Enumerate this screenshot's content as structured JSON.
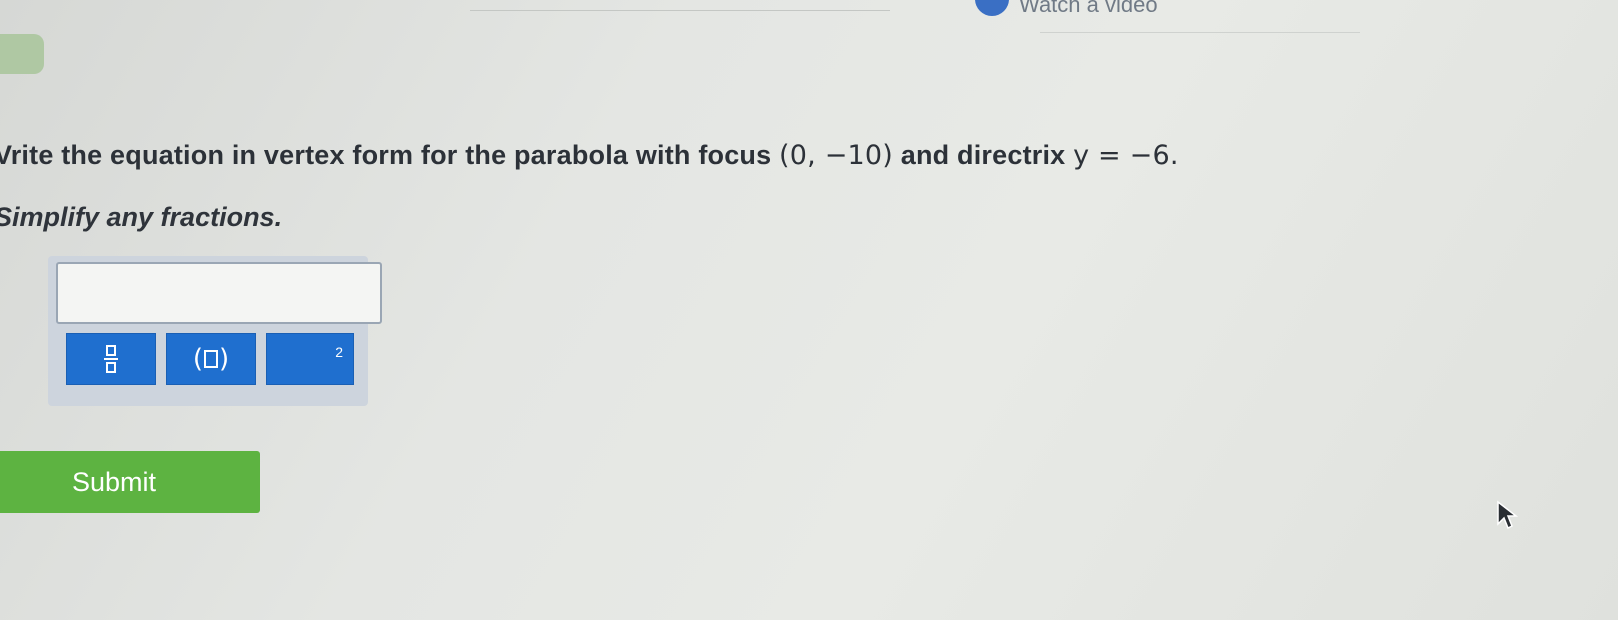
{
  "header": {
    "video_link_label": "Watch a video"
  },
  "question": {
    "prompt_text": "Vrite the equation in vertex form for the parabola with focus",
    "focus": "(0, −10)",
    "connector": "and directrix",
    "directrix": "y = −6.",
    "instruction": "Simplify any fractions."
  },
  "answer": {
    "input_value": "",
    "tools": [
      {
        "name": "fraction",
        "icon": "fraction-icon"
      },
      {
        "name": "parentheses",
        "icon": "parentheses-icon"
      },
      {
        "name": "exponent",
        "icon": "exponent-icon",
        "label": "2"
      }
    ]
  },
  "submit": {
    "label": "Submit"
  },
  "colors": {
    "tool_blue": "#1f6fcf",
    "submit_green": "#5db341",
    "panel": "#cdd4dd"
  }
}
